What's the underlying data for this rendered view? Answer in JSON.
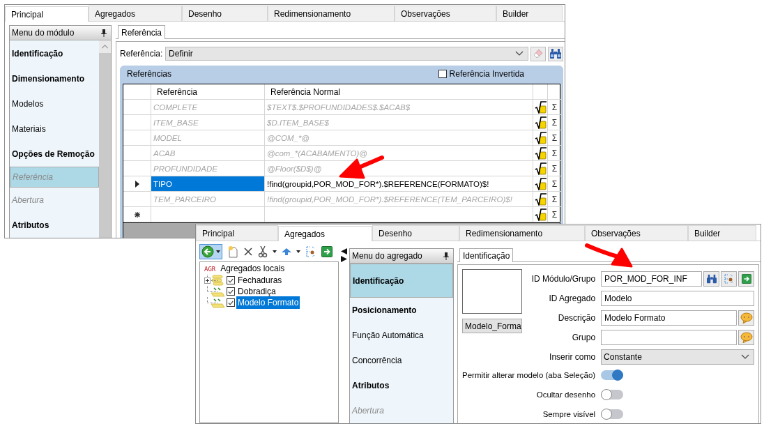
{
  "main_window": {
    "tabs": [
      {
        "label": "Principal",
        "selected": true
      },
      {
        "label": "Agregados",
        "selected": false
      },
      {
        "label": "Desenho",
        "selected": false
      },
      {
        "label": "Redimensionamento",
        "selected": false
      },
      {
        "label": "Observações",
        "selected": false
      },
      {
        "label": "Builder",
        "selected": false
      }
    ],
    "module_menu": {
      "title": "Menu do módulo",
      "items": [
        {
          "label": "Identificação",
          "bold": true,
          "disabled": false,
          "selected": false
        },
        {
          "label": "Dimensionamento",
          "bold": true,
          "disabled": false,
          "selected": false
        },
        {
          "label": "Modelos",
          "bold": false,
          "disabled": false,
          "selected": false
        },
        {
          "label": "Materiais",
          "bold": false,
          "disabled": false,
          "selected": false
        },
        {
          "label": "Opções de Remoção",
          "bold": true,
          "disabled": false,
          "selected": false
        },
        {
          "label": "Referência",
          "bold": false,
          "disabled": true,
          "selected": true
        },
        {
          "label": "Abertura",
          "bold": false,
          "disabled": true,
          "selected": false
        },
        {
          "label": "Atributos",
          "bold": true,
          "disabled": false,
          "selected": false
        }
      ]
    },
    "subtabs": [
      {
        "label": "Referência",
        "selected": true
      }
    ],
    "reference_field": {
      "label": "Referência:",
      "value": "Definir"
    },
    "references": {
      "title": "Referências",
      "inverted": {
        "label": "Referência Invertida",
        "checked": false
      },
      "columns": [
        "Referência",
        "Referência Normal"
      ],
      "rows": [
        {
          "kind": "data",
          "reference": "COMPLETE",
          "normal": "$TEXT$.$PROFUNDIDADES$.$ACAB$",
          "inherited": true,
          "selected": false,
          "sum": "Σ"
        },
        {
          "kind": "data",
          "reference": "ITEM_BASE",
          "normal": "$D.ITEM_BASE$",
          "inherited": true,
          "selected": false,
          "sum": "Σ"
        },
        {
          "kind": "data",
          "reference": "MODEL",
          "normal": "@COM_*@",
          "inherited": true,
          "selected": false,
          "sum": "Σ"
        },
        {
          "kind": "data",
          "reference": "ACAB",
          "normal": "@com_*(ACABAMENTO)@",
          "inherited": true,
          "selected": false,
          "sum": "Σ"
        },
        {
          "kind": "data",
          "reference": "PROFUNDIDADE",
          "normal": "@Floor($D$)@",
          "inherited": true,
          "selected": false,
          "sum": "Σ"
        },
        {
          "kind": "data",
          "reference": "TIPO",
          "normal": "!find(groupid,POR_MOD_FOR*).$REFERENCE(FORMATO)$!",
          "inherited": false,
          "selected": true,
          "sum": "Σ"
        },
        {
          "kind": "data",
          "reference": "TEM_PARCEIRO",
          "normal": "!find(groupid,POR_MOD_FOR*).$REFERENCE(TEM_PARCEIRO)$!",
          "inherited": true,
          "selected": false,
          "sum": "Σ"
        },
        {
          "kind": "new",
          "sum": "Σ"
        }
      ]
    }
  },
  "aggregate_window": {
    "tabs": [
      {
        "label": "Principal",
        "selected": false
      },
      {
        "label": "Agregados",
        "selected": true
      },
      {
        "label": "Desenho",
        "selected": false
      },
      {
        "label": "Redimensionamento",
        "selected": false
      },
      {
        "label": "Observações",
        "selected": false
      },
      {
        "label": "Builder",
        "selected": false
      }
    ],
    "tree": {
      "badge": "AGR",
      "label": "Agregados locais",
      "children": [
        {
          "kind": "group",
          "label": "Fechaduras",
          "checked": true,
          "selected": false
        },
        {
          "kind": "item",
          "label": "Dobradiça",
          "checked": true,
          "selected": false
        },
        {
          "kind": "item",
          "label": "Modelo Formato",
          "checked": true,
          "selected": true
        }
      ]
    },
    "aggregate_menu": {
      "title": "Menu do agregado",
      "items": [
        {
          "label": "Identificação",
          "bold": true,
          "disabled": false,
          "selected": true
        },
        {
          "label": "Posicionamento",
          "bold": true,
          "disabled": false,
          "selected": false
        },
        {
          "label": "Função Automática",
          "bold": false,
          "disabled": false,
          "selected": false
        },
        {
          "label": "Concorrência",
          "bold": false,
          "disabled": false,
          "selected": false
        },
        {
          "label": "Atributos",
          "bold": true,
          "disabled": false,
          "selected": false
        },
        {
          "label": "Abertura",
          "bold": false,
          "disabled": true,
          "selected": false
        }
      ]
    },
    "subtabs": [
      {
        "label": "Identificação",
        "selected": true
      }
    ],
    "image_button": "Modelo_Forma",
    "fields": [
      {
        "kind": "lookup",
        "label": "ID Módulo/Grupo",
        "value": "POR_MOD_FOR_INF"
      },
      {
        "kind": "text",
        "label": "ID Agregado",
        "value": "Modelo"
      },
      {
        "kind": "translate",
        "label": "Descrição",
        "value": "Modelo Formato"
      },
      {
        "kind": "translate",
        "label": "Grupo"
      },
      {
        "kind": "select",
        "label": "Inserir como",
        "value": "Constante"
      }
    ],
    "toggles": [
      {
        "label": "Permitir alterar modelo (aba Seleção)",
        "on": true
      },
      {
        "label": "Ocultar desenho",
        "on": false
      },
      {
        "label": "Sempre visível",
        "on": false
      }
    ]
  }
}
